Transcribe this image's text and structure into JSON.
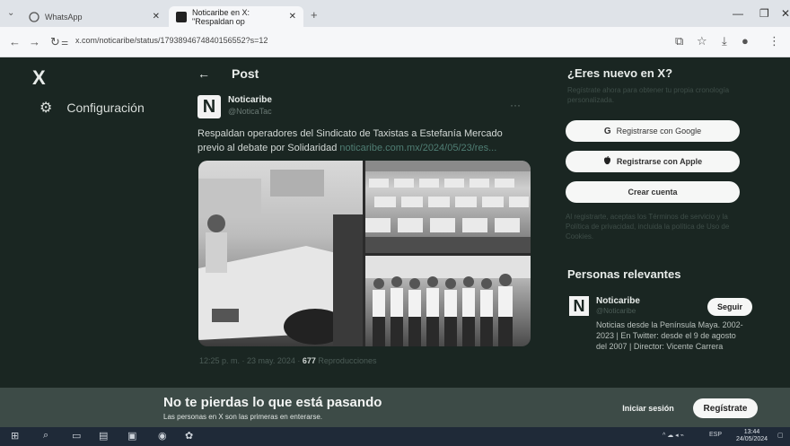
{
  "browser": {
    "tabs": [
      {
        "label": "WhatsApp",
        "active": false
      },
      {
        "label": "Noticaribe en X: \"Respaldan op",
        "active": true
      }
    ],
    "url": "x.com/noticaribe/status/1793894674840156552?s=12",
    "icons": [
      "back-icon",
      "forward-icon",
      "reload-icon",
      "site-info-icon",
      "screenshot-icon",
      "star-icon",
      "download-icon",
      "profile-icon",
      "menu-icon"
    ]
  },
  "sidebar": {
    "logo": "X",
    "settings_label": "Configuración"
  },
  "post": {
    "header_title": "Post",
    "author_name": "Noticaribe",
    "author_handle": "@NoticaTac",
    "avatar_letter": "N",
    "text": "Respaldan operadores del Sindicato de Taxistas a Estefanía Mercado previo al debate por Solidaridad",
    "link_text": "noticaribe.com.mx/2024/05/23/res...",
    "timestamp": "12:25 p. m. · 23 may. 2024 · ",
    "views_count": "677",
    "views_label": " Reproducciones"
  },
  "signup": {
    "title": "¿Eres nuevo en X?",
    "description": "Regístrate ahora para obtener tu propia cronología personalizada.",
    "google_label": "Registrarse con Google",
    "apple_label": "Registrarse con Apple",
    "create_label": "Crear cuenta",
    "legal": "Al registrarte, aceptas los Términos de servicio y la Política de privacidad, incluida la política de Uso de Cookies."
  },
  "relevant": {
    "title": "Personas relevantes",
    "name": "Noticaribe",
    "handle": "@Noticaribe",
    "avatar_letter": "N",
    "follow_label": "Seguir",
    "bio": "Noticias desde la Península Maya. 2002-2023 | En Twitter: desde el 9 de agosto del 2007 | Director: Vicente Carrera"
  },
  "banner": {
    "title": "No te pierdas lo que está pasando",
    "subtitle": "Las personas en X son las primeras en enterarse.",
    "login_label": "Iniciar sesión",
    "register_label": "Regístrate"
  },
  "taskbar": {
    "time": "13:44",
    "date": "24/05/2024",
    "lang": "ESP"
  },
  "colors": {
    "page_bg": "#1a2622",
    "banner_bg": "#3d4b47",
    "link": "#4f7d73"
  }
}
